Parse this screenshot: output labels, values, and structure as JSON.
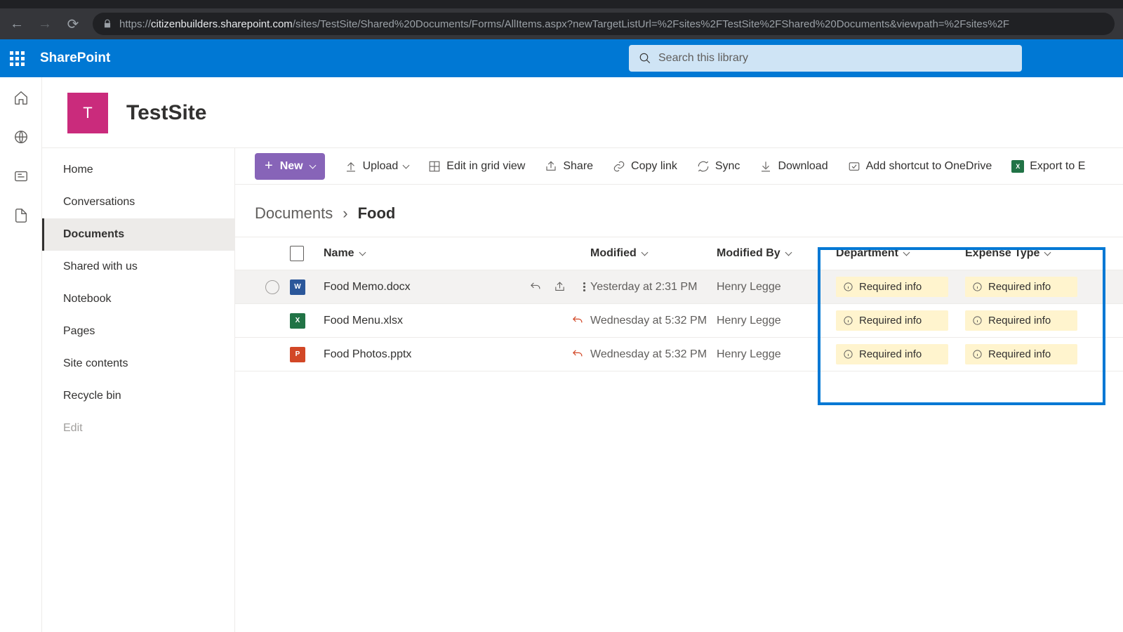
{
  "browser": {
    "url_prefix": "https://",
    "url_domain": "citizenbuilders.sharepoint.com",
    "url_path": "/sites/TestSite/Shared%20Documents/Forms/AllItems.aspx?newTargetListUrl=%2Fsites%2FTestSite%2FShared%20Documents&viewpath=%2Fsites%2F"
  },
  "app_name": "SharePoint",
  "search_placeholder": "Search this library",
  "site": {
    "initial": "T",
    "name": "TestSite"
  },
  "nav": {
    "items": [
      "Home",
      "Conversations",
      "Documents",
      "Shared with us",
      "Notebook",
      "Pages",
      "Site contents",
      "Recycle bin"
    ],
    "active_index": 2,
    "edit": "Edit"
  },
  "commands": {
    "new": "New",
    "upload": "Upload",
    "grid": "Edit in grid view",
    "share": "Share",
    "copy": "Copy link",
    "sync": "Sync",
    "download": "Download",
    "shortcut": "Add shortcut to OneDrive",
    "export": "Export to E"
  },
  "breadcrumb": {
    "parent": "Documents",
    "current": "Food"
  },
  "columns": {
    "name": "Name",
    "modified": "Modified",
    "modified_by": "Modified By",
    "department": "Department",
    "expense_type": "Expense Type"
  },
  "required_info": "Required info",
  "files": [
    {
      "name": "Food Memo.docx",
      "type": "word",
      "modified": "Yesterday at 2:31 PM",
      "by": "Henry Legge",
      "hover": true
    },
    {
      "name": "Food Menu.xlsx",
      "type": "excel",
      "modified": "Wednesday at 5:32 PM",
      "by": "Henry Legge",
      "hover": false
    },
    {
      "name": "Food Photos.pptx",
      "type": "ppt",
      "modified": "Wednesday at 5:32 PM",
      "by": "Henry Legge",
      "hover": false
    }
  ]
}
